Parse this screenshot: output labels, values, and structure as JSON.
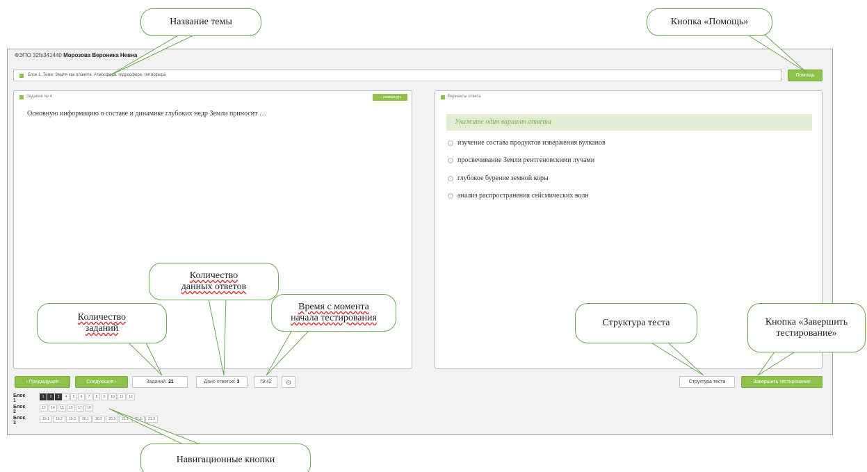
{
  "header": {
    "code": "ФЭПО 32fs341440",
    "user": "Морозова Вероника Н",
    "user_tail": "евна"
  },
  "topic": {
    "text": "Блок 1. Тема: Земля как планета. Атмосфера, гидросфера, литосфера",
    "help_label": "Помощь"
  },
  "task": {
    "header": "Задание № 4",
    "expand_label": "развернуть",
    "question": "Основную информацию о составе и динамике глубоких недр Земли приносит …"
  },
  "answers": {
    "header": "Варианты ответа",
    "hint": "Укажите один вариант ответа",
    "options": [
      "изучение состава продуктов извержения вулканов",
      "просвечивание Земли рентгеновскими лучами",
      "глубокое бурение земной коры",
      "анализ распространения сейсмических волн"
    ]
  },
  "footer": {
    "prev_label": "Предыдущее",
    "next_label": "Следующее",
    "tasks_label": "Заданий:",
    "tasks_count": "21",
    "answered_label": "Дано ответов:",
    "answered_count": "3",
    "timer": "79:42",
    "structure_label": "Структура теста",
    "finish_label": "Завершить тестирование"
  },
  "navigation": [
    {
      "label": "Блок 1",
      "items": [
        "1",
        "2",
        "3",
        "4",
        "5",
        "6",
        "7",
        "8",
        "9",
        "10",
        "11",
        "12"
      ],
      "done": 3
    },
    {
      "label": "Блок 2",
      "items": [
        "13",
        "14",
        "15",
        "16",
        "17",
        "18"
      ],
      "done": 0
    },
    {
      "label": "Блок 3",
      "items": [
        "19.1",
        "19.2",
        "19.3",
        "20.1",
        "20.2",
        "20.3",
        "21.1",
        "21.2",
        "21.3"
      ],
      "done": 0
    }
  ],
  "callouts": {
    "topic_name": "Название темы",
    "help_button": "Кнопка «Помощь»",
    "tasks_count_1": "Количество",
    "tasks_count_2": "заданий",
    "answers_count_1": "Количество",
    "answers_count_2": "данных ответов",
    "time_1": "Время с момента",
    "time_2": "начала тестирования",
    "structure": "Структура теста",
    "finish_1": "Кнопка «Завершить",
    "finish_2": "тестирование»",
    "nav_buttons": "Навигационные кнопки"
  },
  "colors": {
    "accent": "#8dc14a",
    "callout_border": "#6aaa4a",
    "hint_bg": "#dfeed0"
  }
}
